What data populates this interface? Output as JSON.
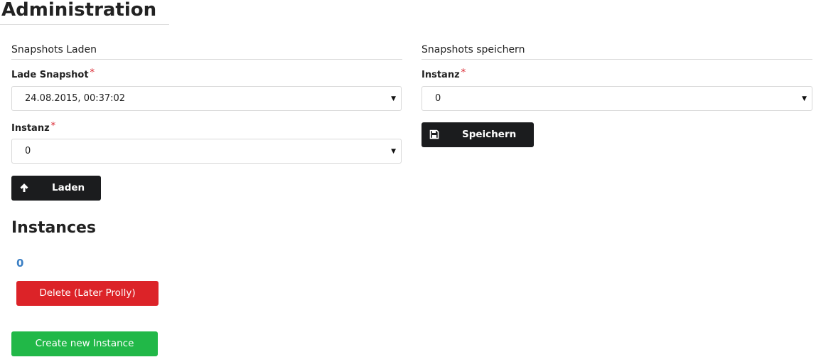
{
  "page": {
    "title": "Administration"
  },
  "load_section": {
    "heading": "Snapshots Laden",
    "snapshot_label": "Lade Snapshot",
    "snapshot_value": "24.08.2015, 00:37:02",
    "instance_label": "Instanz",
    "instance_value": "0",
    "load_button": "Laden",
    "required_marker": "*"
  },
  "save_section": {
    "heading": "Snapshots speichern",
    "instance_label": "Instanz",
    "instance_value": "0",
    "save_button": "Speichern",
    "required_marker": "*"
  },
  "instances": {
    "heading": "Instances",
    "items": [
      {
        "name": "0",
        "delete_button": "Delete (Later Prolly)"
      }
    ],
    "create_button": "Create new Instance"
  },
  "icons": {
    "load": "arrow-up-icon",
    "save": "floppy-disk-icon",
    "dropdown": "caret-down-icon"
  },
  "colors": {
    "dark_button": "#1b1c1e",
    "danger": "#dc2328",
    "success": "#21b848",
    "link": "#3b7fc4",
    "required": "#d9232d"
  }
}
